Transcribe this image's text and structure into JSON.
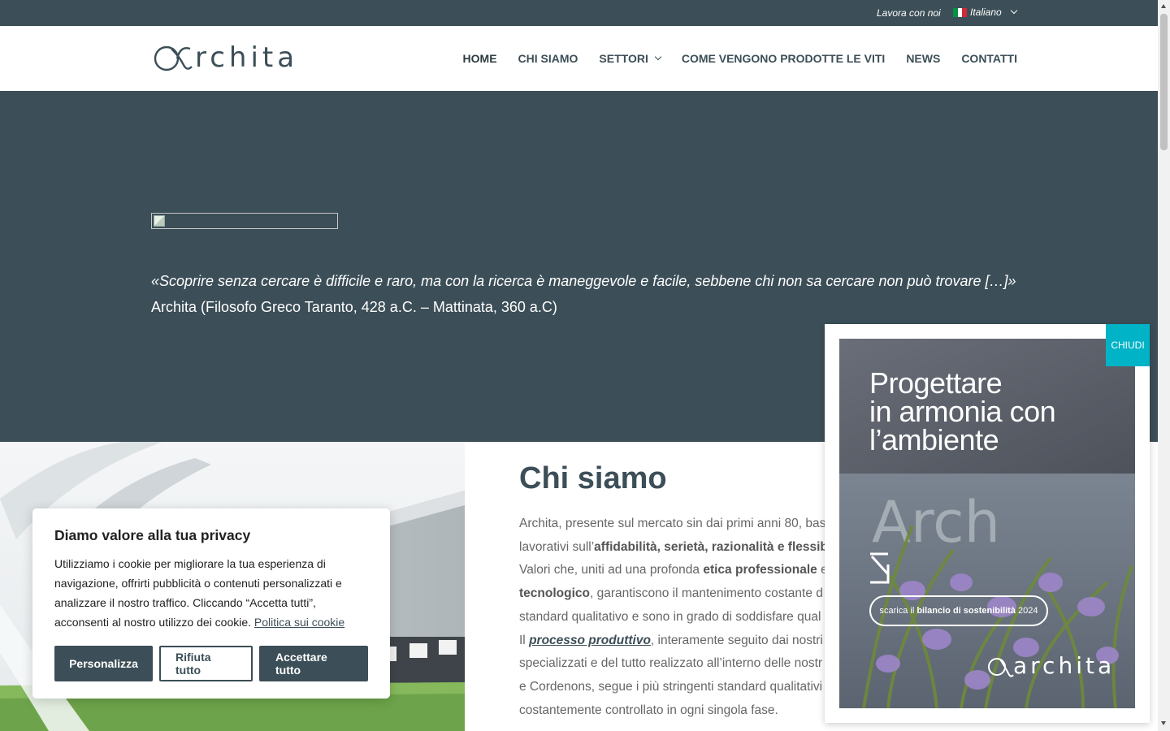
{
  "topbar": {
    "work_link": "Lavora con noi",
    "language": "Italiano"
  },
  "header": {
    "logo_alt": "archita",
    "nav": [
      {
        "label": "HOME"
      },
      {
        "label": "CHI SIAMO"
      },
      {
        "label": "SETTORI"
      },
      {
        "label": "COME VENGONO PRODOTTE LE VITI"
      },
      {
        "label": "NEWS"
      },
      {
        "label": "CONTATTI"
      }
    ]
  },
  "hero": {
    "quote": "«Scoprire senza cercare è difficile e raro, ma con la ricerca è maneggevole e facile, sebbene chi non sa cercare non può trovare […]»",
    "author": "Archita (Filosofo Greco Taranto, 428 a.C. – Mattinata, 360 a.C)"
  },
  "chi_siamo": {
    "title": "Chi siamo",
    "p1_a": "Archita, presente sul mercato sin dai primi anni 80, bas",
    "p1_b": "lavorativi sull’",
    "p1_bold1": "affidabilità, serietà, razionalità e flessib",
    "p1_c": "Valori che, uniti ad una profonda ",
    "p1_bold2": "etica professionale",
    "p1_d": " e",
    "p1_bold3": "tecnologico",
    "p1_e": ", garantiscono il mantenimento costante d",
    "p1_f": "standard qualitativo e sono in grado di soddisfare qual",
    "p2_a": "Il ",
    "p2_link": "processo produttivo",
    "p2_b": ", interamente seguito dai nostri in",
    "p2_c": "specializzati e del tutto realizzato all’interno delle nostr",
    "p2_d": "e Cordenons, segue i più stringenti standard qualitativi",
    "p2_e": "costantemente controllato in ogni singola fase."
  },
  "cookie": {
    "title": "Diamo valore alla tua privacy",
    "text": "Utilizziamo i cookie per migliorare la tua esperienza di navigazione, offrirti pubblicità o contenuti personalizzati e analizzare il nostro traffico. Cliccando “Accetta tutti”, acconsenti al nostro utilizzo dei cookie. ",
    "policy_link": "Politica sui cookie",
    "btn_customize": "Personalizza",
    "btn_reject": "Rifiuta tutto",
    "btn_accept": "Accettare tutto"
  },
  "popup": {
    "close": "CHIUDI",
    "heading_1": "Progettare",
    "heading_2": "in armonia con",
    "heading_3": "l’ambiente",
    "pill_a": "scarica il",
    "pill_bold": "bilancio di sostenibilità",
    "pill_b": "2024",
    "brand": "archita"
  },
  "colors": {
    "primary": "#3c4e57",
    "accent": "#00b3c7",
    "white": "#ffffff"
  }
}
